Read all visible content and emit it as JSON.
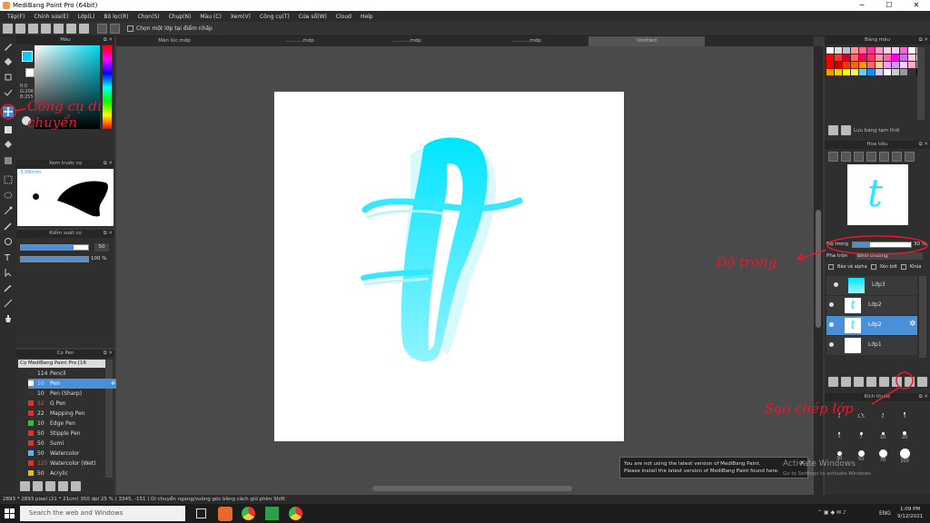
{
  "window": {
    "title": "MediBang Paint Pro (64bit)"
  },
  "menu": [
    "Tệp(F)",
    "Chỉnh sửa(E)",
    "Lớp(L)",
    "Bộ lọc(R)",
    "Chọn(S)",
    "Chụp(N)",
    "Màu (C)",
    "Xem(V)",
    "Công cụ(T)",
    "Cửa sổ(W)",
    "Cloud",
    "Help"
  ],
  "toolbar": {
    "select_layer_label": "Chọn một lớp tại điểm nhấp"
  },
  "color_panel": {
    "title": "Màu",
    "rgb": [
      "R:0",
      "G:206",
      "B:255"
    ]
  },
  "brush_preview": {
    "title": "Xem trước cọ",
    "size": "3.08mm"
  },
  "brush_control": {
    "title": "Kiểm soát cọ",
    "size_value": "50",
    "opacity_value": "100 %"
  },
  "brush_list": {
    "title": "Cọ Pen",
    "group": "Cọ MediBang Paint Pro [16",
    "items": [
      {
        "num": "114",
        "name": "Pencil",
        "color": "#333333"
      },
      {
        "num": "10",
        "name": "Pen",
        "color": "#ffffff"
      },
      {
        "num": "10",
        "name": "Pen (Sharp)",
        "color": "#333333"
      },
      {
        "num": "32",
        "name": "G Pen",
        "color": "#e03030"
      },
      {
        "num": "22",
        "name": "Mapping Pen",
        "color": "#e03030"
      },
      {
        "num": "10",
        "name": "Edge Pen",
        "color": "#30c030"
      },
      {
        "num": "50",
        "name": "Stipple Pen",
        "color": "#e03030"
      },
      {
        "num": "50",
        "name": "Sumi",
        "color": "#e03030"
      },
      {
        "num": "50",
        "name": "Watercolor",
        "color": "#60b0ff"
      },
      {
        "num": "125",
        "name": "Watercolor (Wet)",
        "color": "#e03030"
      },
      {
        "num": "50",
        "name": "Acrylic",
        "color": "#e0c020"
      }
    ]
  },
  "tabs": [
    "Màn lúc.mdp",
    "...........mdp",
    "...........mdp",
    "...........mdp",
    "Untitled"
  ],
  "canvas": {
    "letter": "t"
  },
  "palette": {
    "title": "Bảng màu",
    "temp_label": "Lưu bảng tạm thời"
  },
  "navigator": {
    "title": "Hoa tiêu"
  },
  "layer_panel": {
    "opacity_label": "Độ trong",
    "opacity_value": "30 %",
    "blend_label": "Pha trộn",
    "blend_value": "Bình thường",
    "protect_alpha": "Bảo vệ alpha",
    "clipping": "Xén bớt",
    "lock": "Khóa",
    "layers": [
      {
        "name": "Lớp3",
        "selected": false
      },
      {
        "name": "Lớp2",
        "selected": false
      },
      {
        "name": "Lớp2",
        "selected": true
      },
      {
        "name": "Lớp1",
        "selected": false
      }
    ]
  },
  "brush_size_panel": {
    "title": "Kích thước",
    "sizes": [
      "1",
      "1.5",
      "2",
      "3",
      "5",
      "7",
      "10",
      "20",
      "30",
      "50",
      "70",
      "100"
    ]
  },
  "notice": {
    "line1": "You are not using the latest version of MediBang Paint.",
    "line2": "Please install the latest version of MediBang Paint found here."
  },
  "watermark": {
    "line1": "Activate Windows",
    "line2": "Go to Settings to activate Windows."
  },
  "status": {
    "text": "2893 * 2893 pixel  (21 * 21cm)  350 dpi  25 %  ( 3345, -151 )  Di chuyển ngang/vuông góc bằng cách giữ phím Shift"
  },
  "taskbar": {
    "search_placeholder": "Search the web and Windows",
    "lang": "ENG",
    "time": "1:09 PM",
    "date": "9/12/2021"
  },
  "annotations": {
    "move_tool": "Công cụ di chuyển",
    "opacity": "Độ trong",
    "copy_layer": "Sao chép lớp"
  },
  "colors": {
    "accent": "#3b8fe0",
    "cyan": "#00e5ff",
    "annotation": "#e8192c"
  }
}
